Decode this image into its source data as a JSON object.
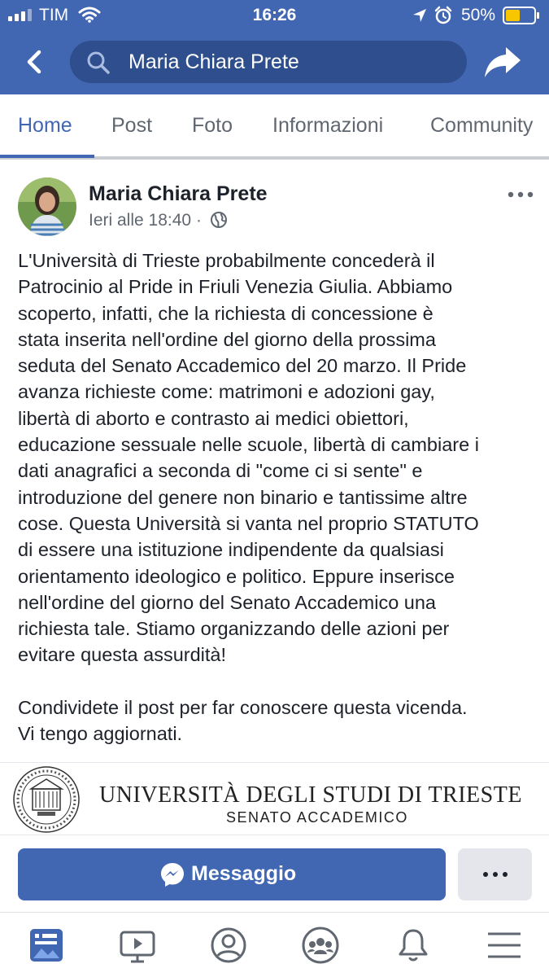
{
  "status_bar": {
    "carrier": "TIM",
    "time": "16:26",
    "battery_percent": "50%",
    "battery_level": 0.5,
    "icons": [
      "signal-icon",
      "wifi-icon",
      "location-icon",
      "alarm-icon",
      "battery-icon"
    ]
  },
  "header": {
    "search_value": "Maria Chiara Prete",
    "bar_color": "#4267b2"
  },
  "tabs": [
    {
      "label": "Home",
      "active": true
    },
    {
      "label": "Post",
      "active": false
    },
    {
      "label": "Foto",
      "active": false
    },
    {
      "label": "Informazioni",
      "active": false
    },
    {
      "label": "Community",
      "active": false
    }
  ],
  "post": {
    "author": "Maria Chiara Prete",
    "timestamp": "Ieri alle 18:40",
    "separator": "·",
    "privacy_icon": "globe-icon",
    "text": "L'Università di Trieste probabilmente concederà il\nPatrocinio al Pride in Friuli Venezia Giulia. Abbiamo\nscoperto, infatti, che la richiesta di concessione è\nstata inserita nell'ordine del giorno della prossima\nseduta del Senato Accademico del 20 marzo. Il Pride\navanza richieste come: matrimoni e adozioni gay,\nlibertà di aborto e contrasto ai medici obiettori,\neducazione sessuale nelle scuole, libertà di cambiare i\ndati anagrafici a seconda di \"come ci si sente\" e\nintroduzione del genere non binario e tantissime altre\ncose. Questa Università si vanta nel proprio STATUTO\ndi essere una istituzione indipendente da qualsiasi\norientamento ideologico e politico. Eppure inserisce\nnell'ordine del giorno del Senato Accademico una\nrichiesta tale. Stiamo organizzando delle azioni per\nevitare questa assurdità!\n\nCondividete il post per far conoscere questa vicenda.\nVi tengo aggiornati."
  },
  "banner": {
    "title": "UNIVERSITÀ DEGLI STUDI DI TRIESTE",
    "subtitle": "SENATO ACCADEMICO"
  },
  "actions": {
    "message_label": "Messaggio",
    "message_icon": "messenger-icon",
    "more_icon": "more-dots-icon",
    "accent": "#4267b2"
  },
  "bottom_nav": [
    {
      "icon": "news-feed-icon",
      "active": true
    },
    {
      "icon": "watch-video-icon",
      "active": false
    },
    {
      "icon": "profile-icon",
      "active": false
    },
    {
      "icon": "groups-icon",
      "active": false
    },
    {
      "icon": "notifications-bell-icon",
      "active": false
    },
    {
      "icon": "menu-icon",
      "active": false
    }
  ]
}
